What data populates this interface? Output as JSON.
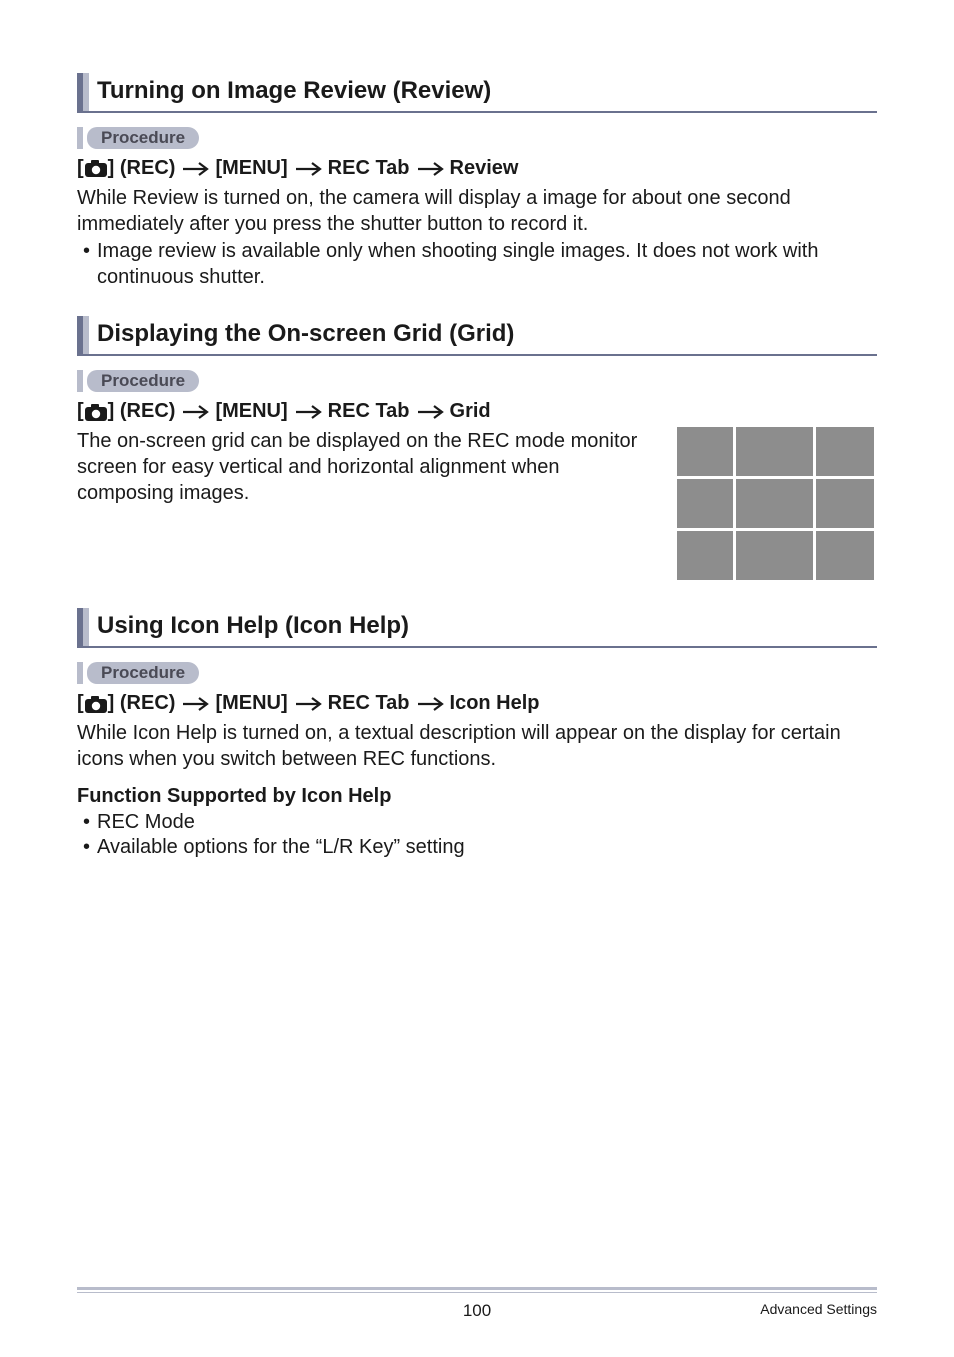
{
  "procedure_label": "Procedure",
  "sections": [
    {
      "title": "Turning on Image Review (Review)",
      "path": [
        "(REC)",
        "[MENU]",
        "REC Tab",
        "Review"
      ],
      "body": "While Review is turned on, the camera will display a image for about one second immediately after you press the shutter button to record it.",
      "bullets": [
        "Image review is available only when shooting single images. It does not work with continuous shutter."
      ]
    },
    {
      "title": "Displaying the On-screen Grid (Grid)",
      "path": [
        "(REC)",
        "[MENU]",
        "REC Tab",
        "Grid"
      ],
      "body": "The on-screen grid can be displayed on the REC mode monitor screen for easy vertical and horizontal alignment when composing images."
    },
    {
      "title": "Using Icon Help (Icon Help)",
      "path": [
        "(REC)",
        "[MENU]",
        "REC Tab",
        "Icon Help"
      ],
      "body": "While Icon Help is turned on, a textual description will appear on the display for certain icons when you switch between REC functions.",
      "subheading": "Function Supported by Icon Help",
      "sub_bullets": [
        "REC Mode",
        "Available options for the “L/R Key” setting"
      ]
    }
  ],
  "footer": {
    "page": "100",
    "label": "Advanced Settings"
  }
}
